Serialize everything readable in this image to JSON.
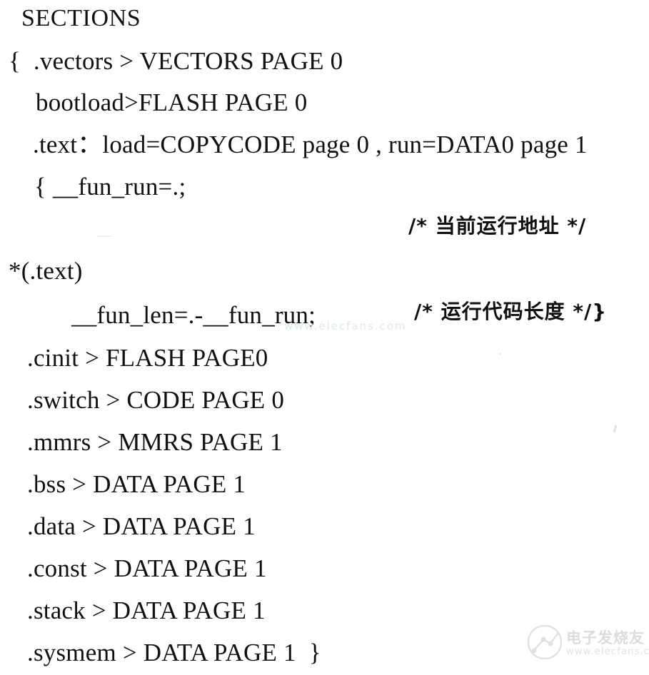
{
  "document": {
    "kind": "scanned-page",
    "background_color": "#ffffff",
    "ink_color": "#111111",
    "title_line": "SECTIONS"
  },
  "code": {
    "lines": [
      {
        "id": "sections",
        "text": "SECTIONS"
      },
      {
        "id": "vectors",
        "text": "{  .vectors > VECTORS PAGE 0"
      },
      {
        "id": "bootload",
        "text": "bootload>FLASH PAGE 0"
      },
      {
        "id": "text",
        "text": ".text：load=COPYCODE page 0 , run=DATA0 page 1"
      },
      {
        "id": "fun_run",
        "text": "{ __fun_run=.;"
      },
      {
        "id": "star_text",
        "text": "*(.text)"
      },
      {
        "id": "fun_len",
        "text": "__fun_len=.-__fun_run;"
      },
      {
        "id": "cinit",
        "text": ".cinit > FLASH PAGE0"
      },
      {
        "id": "switch",
        "text": ".switch > CODE PAGE 0"
      },
      {
        "id": "mmrs",
        "text": ".mmrs > MMRS PAGE 1"
      },
      {
        "id": "bss",
        "text": ".bss > DATA PAGE 1"
      },
      {
        "id": "data",
        "text": ".data > DATA PAGE 1"
      },
      {
        "id": "const",
        "text": ".const > DATA PAGE 1"
      },
      {
        "id": "stack",
        "text": ".stack > DATA PAGE 1"
      },
      {
        "id": "sysmem",
        "text": ".sysmem > DATA PAGE 1  }"
      }
    ]
  },
  "comments": {
    "current_run_address": "/* 当前运行地址 */",
    "run_code_length": "/* 运行代码长度 */}"
  },
  "watermarks": {
    "faint_center": "www.elecfans.com",
    "site_name_cn": "电子发烧友",
    "site_url": "www.elecfans.com"
  }
}
